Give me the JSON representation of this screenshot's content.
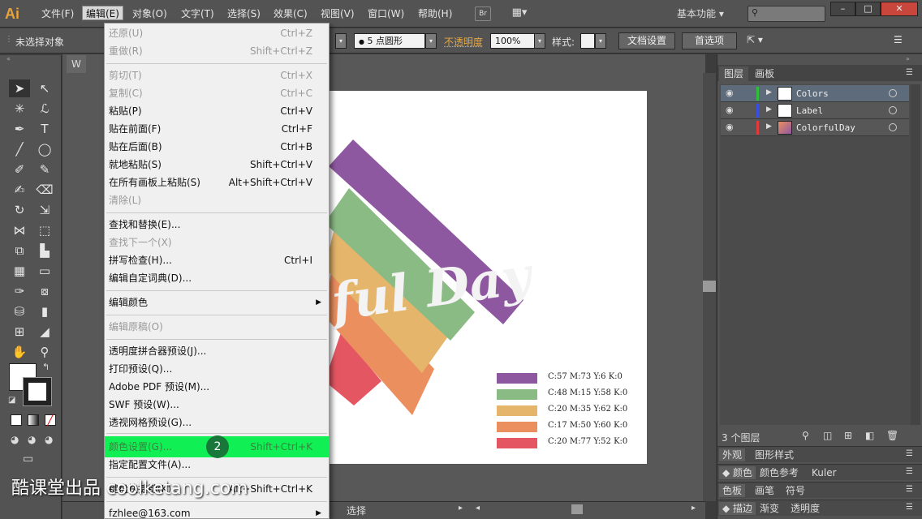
{
  "app": {
    "logo": "Ai"
  },
  "menubar": {
    "items": [
      "文件(F)",
      "编辑(E)",
      "对象(O)",
      "文字(T)",
      "选择(S)",
      "效果(C)",
      "视图(V)",
      "窗口(W)",
      "帮助(H)"
    ],
    "bridge": "Br",
    "workspace": "基本功能"
  },
  "controlbar": {
    "selection": "未选择对象",
    "brush": "5 点圆形",
    "opacity_label": "不透明度",
    "opacity_value": "100%",
    "style_label": "样式:",
    "doc_setup": "文档设置",
    "preferences": "首选项"
  },
  "document": {
    "tab": "W",
    "status": "选择"
  },
  "artwork": {
    "title_text": "ful Day",
    "legend": [
      {
        "label": "C:57 M:73 Y:6 K:0",
        "color": "#8e58a1"
      },
      {
        "label": "C:48 M:15 Y:58 K:0",
        "color": "#8bbb85"
      },
      {
        "label": "C:20 M:35 Y:62 K:0",
        "color": "#e4b56b"
      },
      {
        "label": "C:17 M:50 Y:60 K:0",
        "color": "#eb8f5f"
      },
      {
        "label": "C:20 M:77 Y:52 K:0",
        "color": "#e55663"
      }
    ]
  },
  "layers_panel": {
    "tabs": [
      "图层",
      "画板"
    ],
    "layers": [
      {
        "name": "Colors",
        "color": "#2fbf3a"
      },
      {
        "name": "Label",
        "color": "#3a4fe0"
      },
      {
        "name": "ColorfulDay",
        "color": "#e03a3a"
      }
    ],
    "count": "3 个图层"
  },
  "panel_strips": [
    {
      "tabs": [
        "外观",
        "图形样式"
      ]
    },
    {
      "tabs": [
        "颜色",
        "颜色参考",
        "Kuler"
      ]
    },
    {
      "tabs": [
        "色板",
        "画笔",
        "符号"
      ]
    },
    {
      "tabs": [
        "描边",
        "渐变",
        "透明度"
      ]
    }
  ],
  "edit_menu": {
    "items": [
      {
        "label": "还原(U)",
        "shortcut": "Ctrl+Z",
        "disabled": true
      },
      {
        "label": "重做(R)",
        "shortcut": "Shift+Ctrl+Z",
        "disabled": true
      },
      {
        "label": "剪切(T)",
        "shortcut": "Ctrl+X",
        "disabled": true
      },
      {
        "label": "复制(C)",
        "shortcut": "Ctrl+C",
        "disabled": true
      },
      {
        "label": "粘贴(P)",
        "shortcut": "Ctrl+V"
      },
      {
        "label": "贴在前面(F)",
        "shortcut": "Ctrl+F"
      },
      {
        "label": "贴在后面(B)",
        "shortcut": "Ctrl+B"
      },
      {
        "label": "就地粘贴(S)",
        "shortcut": "Shift+Ctrl+V"
      },
      {
        "label": "在所有画板上粘贴(S)",
        "shortcut": "Alt+Shift+Ctrl+V"
      },
      {
        "label": "清除(L)",
        "shortcut": "",
        "disabled": true
      },
      {
        "label": "查找和替换(E)...",
        "shortcut": ""
      },
      {
        "label": "查找下一个(X)",
        "shortcut": "",
        "disabled": true
      },
      {
        "label": "拼写检查(H)...",
        "shortcut": "Ctrl+I"
      },
      {
        "label": "编辑自定词典(D)...",
        "shortcut": ""
      },
      {
        "label": "编辑颜色",
        "shortcut": "",
        "submenu": true
      },
      {
        "label": "编辑原稿(O)",
        "shortcut": "",
        "disabled": true
      },
      {
        "label": "透明度拼合器预设(J)...",
        "shortcut": ""
      },
      {
        "label": "打印预设(Q)...",
        "shortcut": ""
      },
      {
        "label": "Adobe PDF 预设(M)...",
        "shortcut": ""
      },
      {
        "label": "SWF 预设(W)...",
        "shortcut": ""
      },
      {
        "label": "透视网格预设(G)...",
        "shortcut": ""
      },
      {
        "label": "颜色设置(G)...",
        "shortcut": "Shift+Ctrl+K",
        "highlighted": true
      },
      {
        "label": "指定配置文件(A)...",
        "shortcut": ""
      },
      {
        "label": "键盘快捷键(K)...",
        "shortcut": "Alt+Shift+Ctrl+K"
      },
      {
        "label": "fzhlee@163.com",
        "shortcut": "",
        "submenu": true
      }
    ],
    "step_badge": "2"
  },
  "watermark": "酷课堂出品 coolketang.com"
}
